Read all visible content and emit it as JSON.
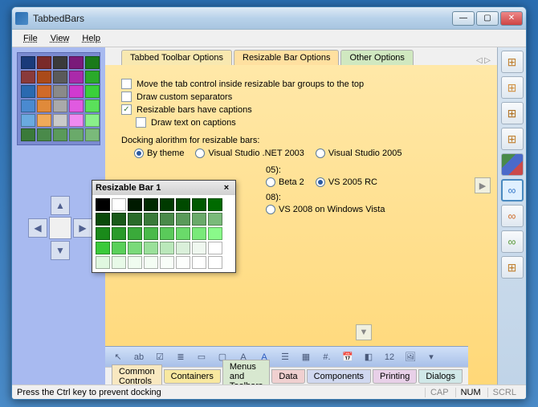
{
  "window": {
    "title": "TabbedBars"
  },
  "menu": {
    "file": "File",
    "view": "View",
    "help": "Help"
  },
  "tabs": {
    "t1": "Tabbed Toolbar Options",
    "t2": "Resizable Bar Options",
    "t3": "Other Options",
    "nav": "◁  ▷"
  },
  "opts": {
    "move_top": "Move the tab control inside resizable bar groups to the top",
    "custom_sep": "Draw custom separators",
    "captions": "Resizable bars have captions",
    "draw_text": "Draw text on captions",
    "dock_label": "Docking alorithm for resizable bars:",
    "by_theme": "By theme",
    "vs2003": "Visual Studio .NET 2003",
    "vs2005": "Visual Studio 2005",
    "line2_suffix": "05):",
    "beta2": "Beta 2",
    "vs2005rc": "VS 2005 RC",
    "line3_suffix": "08):",
    "vs2008vista": "VS 2008 on Windows Vista"
  },
  "float": {
    "title": "Resizable Bar 1",
    "close": "×"
  },
  "bottom_tabs": {
    "b0": "Common Controls",
    "b1": "Containers",
    "b2": "Menus and Toolbars",
    "b3": "Data",
    "b4": "Components",
    "b5": "Printing",
    "b6": "Dialogs"
  },
  "status": {
    "msg": "Press the Ctrl key to prevent docking",
    "cap": "CAP",
    "num": "NUM",
    "scrl": "SCRL"
  },
  "palette_colors": [
    "#1a3a7a",
    "#7a2a2a",
    "#3a3a3a",
    "#7a1a7a",
    "#1a7a1a",
    "#8a3a3a",
    "#aa4a1a",
    "#5a5a5a",
    "#aa2aaa",
    "#2aaa2a",
    "#2a6ab0",
    "#d06a2a",
    "#8a8a8a",
    "#d03ad0",
    "#3ad03a",
    "#4a8ad0",
    "#e08a3a",
    "#aaaaaa",
    "#e05ae0",
    "#5ae05a",
    "#6aaae0",
    "#f0aa5a",
    "#cacaca",
    "#f08af0",
    "#8af08a",
    "#3a7a3a",
    "#4a8a4a",
    "#5a9a5a",
    "#6aaa6a",
    "#7aba7a"
  ],
  "float_colors": [
    "#000000",
    "#ffffff",
    "#001a00",
    "#002a00",
    "#003a00",
    "#004a00",
    "#005a00",
    "#006a00",
    "#0a4a0a",
    "#1a5a1a",
    "#2a6a2a",
    "#3a7a3a",
    "#4a8a4a",
    "#5a9a5a",
    "#6aaa6a",
    "#7aba7a",
    "#1a8a1a",
    "#2a9a2a",
    "#3aaa3a",
    "#4aba4a",
    "#5aca5a",
    "#6ada6a",
    "#7aea7a",
    "#8afa8a",
    "#3aca3a",
    "#5ad05a",
    "#7ada7a",
    "#9ae09a",
    "#bae8ba",
    "#daf0da",
    "#f0f8f0",
    "#ffffff",
    "#e0f8e0",
    "#e8fae8",
    "#f0fcf0",
    "#f4fdf4",
    "#f8fef8",
    "#fcfefc",
    "#ffffff",
    "#ffffff"
  ],
  "chart_data": {
    "type": "table",
    "note": "no chart present"
  }
}
